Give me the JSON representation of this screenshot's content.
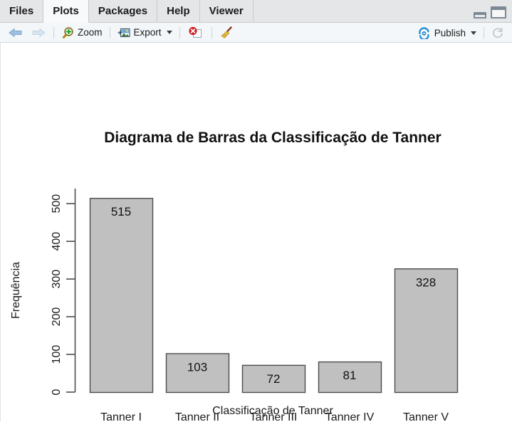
{
  "tabs": [
    {
      "label": "Files",
      "active": false
    },
    {
      "label": "Plots",
      "active": true
    },
    {
      "label": "Packages",
      "active": false
    },
    {
      "label": "Help",
      "active": false
    },
    {
      "label": "Viewer",
      "active": false
    }
  ],
  "window_controls": {
    "minimize": "minimize-icon",
    "maximize": "maximize-icon"
  },
  "toolbar": {
    "back_icon": "back-arrow-icon",
    "forward_icon": "forward-arrow-icon",
    "zoom_label": "Zoom",
    "zoom_icon": "magnifier-plus-icon",
    "export_label": "Export",
    "export_icon": "export-image-icon",
    "remove_icon": "remove-plot-icon",
    "clear_icon": "clear-all-broom-icon",
    "publish_label": "Publish",
    "publish_icon": "publish-icon",
    "refresh_icon": "refresh-icon"
  },
  "colors": {
    "bar_fill": "#c0c0c0",
    "bar_stroke": "#4d4d4d",
    "axis": "#4d4d4d",
    "text": "#1a1a1a",
    "tab_bar": "#e5e6e8",
    "toolbar": "#f3f7f9",
    "publish_blue": "#1f8ad6"
  },
  "chart_data": {
    "type": "bar",
    "title": "Diagrama de Barras da Classificação de Tanner",
    "xlabel": "Classificação de Tanner",
    "ylabel": "Frequência",
    "categories": [
      "Tanner I",
      "Tanner II",
      "Tanner III",
      "Tanner IV",
      "Tanner V"
    ],
    "values": [
      515,
      103,
      72,
      81,
      328
    ],
    "value_labels": [
      "515",
      "103",
      "72",
      "81",
      "328"
    ],
    "yticks": [
      0,
      100,
      200,
      300,
      400,
      500
    ],
    "ytick_labels": [
      "0",
      "100",
      "200",
      "300",
      "400",
      "500"
    ],
    "ylim": [
      0,
      540
    ],
    "grid": false,
    "legend": false,
    "bar_fill": "#c0c0c0",
    "bar_stroke": "#4d4d4d"
  }
}
